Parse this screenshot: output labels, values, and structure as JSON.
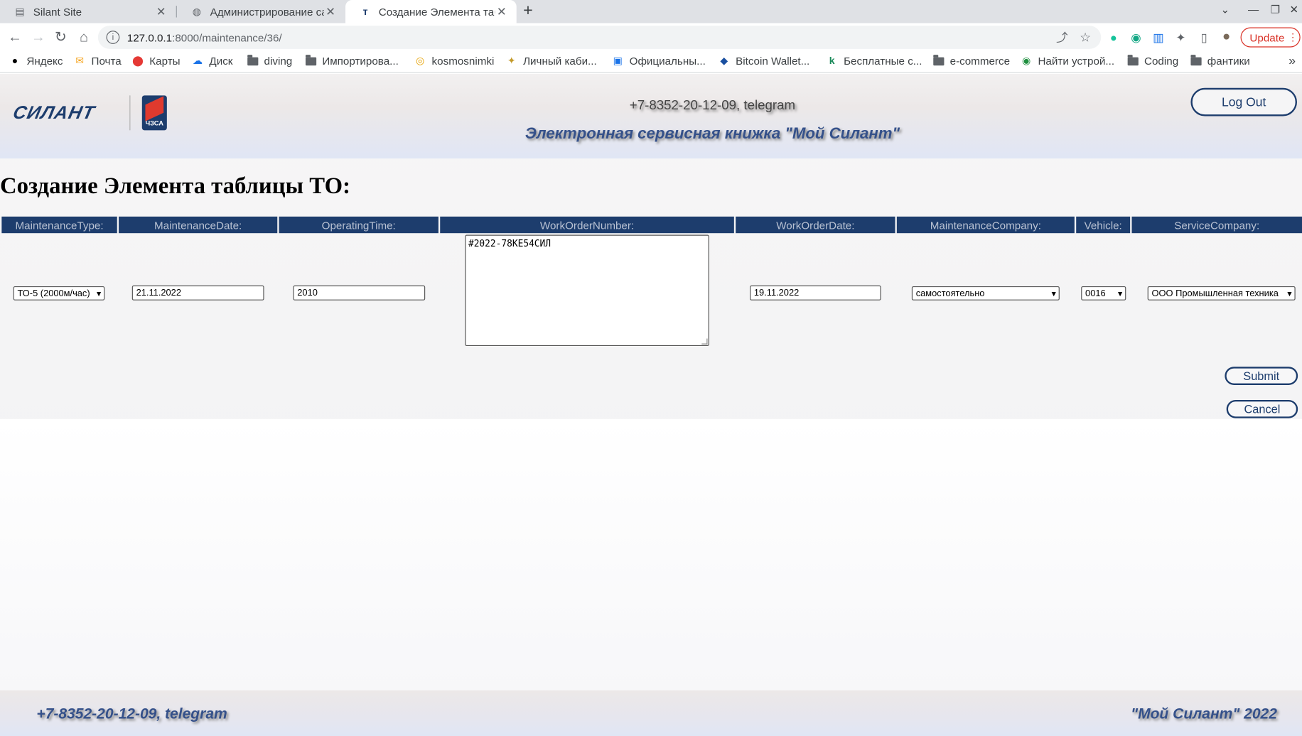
{
  "browser": {
    "tabs": [
      {
        "title": "Silant Site",
        "icon": "doc-icon"
      },
      {
        "title": "Администрирование сай",
        "icon": "globe-icon"
      },
      {
        "title": "Создание Элемента табл",
        "icon": "silant-icon"
      }
    ],
    "url_host": "127.0.0.1",
    "url_path": ":8000/maintenance/36/",
    "update_label": "Update",
    "bookmarks": [
      "Яндекс",
      "Почта",
      "Карты",
      "Диск",
      "diving",
      "Импортирова...",
      "kosmosnimki",
      "Личный каби...",
      "Официальны...",
      "Bitcoin Wallet...",
      "Бесплатные с...",
      "e-commerce",
      "Найти устрой...",
      "Coding",
      "фантики"
    ],
    "more": "»"
  },
  "header": {
    "logo_text": "СИЛАНТ",
    "badge_text": "ЧЗСА",
    "phone": "+7-8352-20-12-09, telegram",
    "subtitle": "Электронная сервисная книжка \"Мой Силант\"",
    "logout_label": "Log Out"
  },
  "page_title": "Создание Элемента таблицы ТО:",
  "columns": [
    "MaintenanceType:",
    "MaintenanceDate:",
    "OperatingTime:",
    "WorkOrderNumber:",
    "WorkOrderDate:",
    "MaintenanceCompany:",
    "Vehicle:",
    "ServiceCompany:"
  ],
  "form": {
    "maintenance_type": "ТО-5 (2000м/час)",
    "maintenance_date": "21.11.2022",
    "operating_time": "2010",
    "work_order_number": "#2022-78КЕ54СИЛ",
    "work_order_date": "19.11.2022",
    "maintenance_company": "самостоятельно",
    "vehicle": "0016",
    "service_company": "ООО Промышленная техника"
  },
  "buttons": {
    "submit": "Submit",
    "cancel": "Cancel"
  },
  "footer": {
    "phone": "+7-8352-20-12-09, telegram",
    "brand": "\"Мой Силант\" 2022"
  },
  "colors": {
    "brand_navy": "#1d3d6d",
    "subtitle_blue": "#35518a",
    "update_red": "#d93025"
  }
}
